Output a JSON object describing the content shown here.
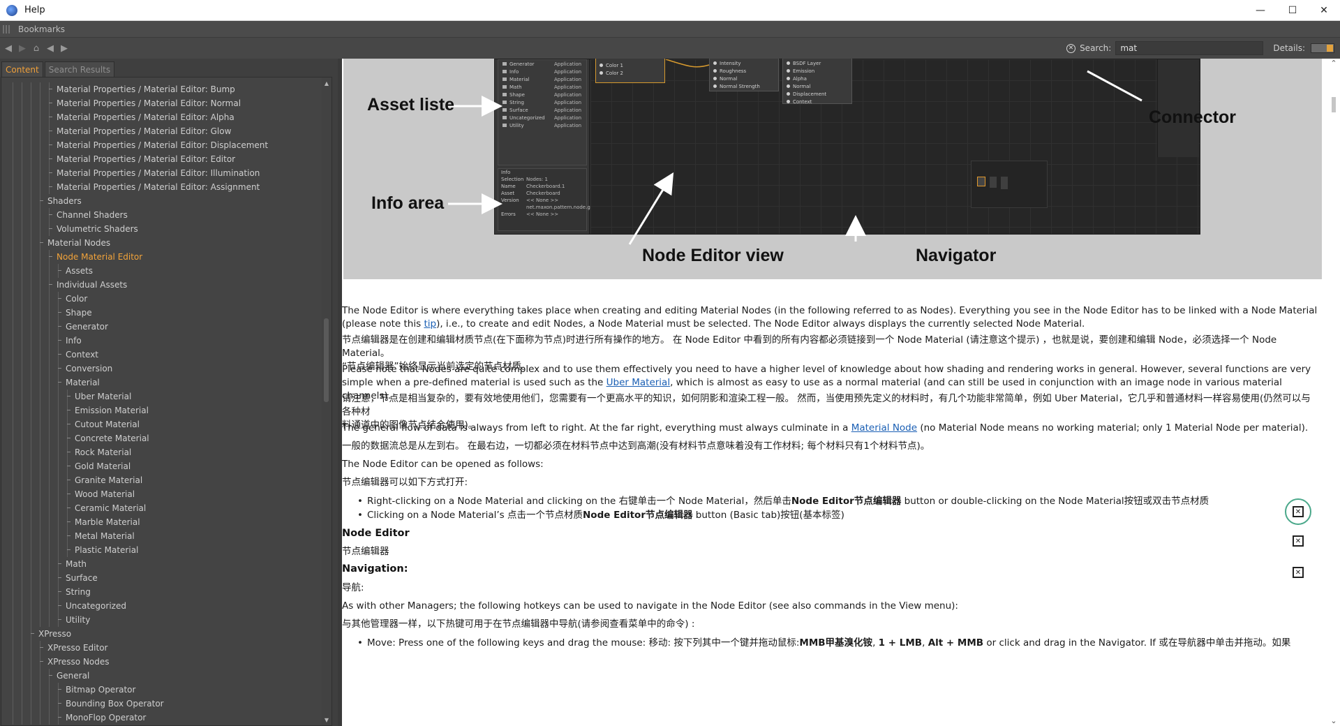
{
  "window": {
    "title": "Help"
  },
  "bookmarks": {
    "label": "Bookmarks"
  },
  "toolbar": {
    "search_label": "Search:",
    "search_value": "mat",
    "details_label": "Details:"
  },
  "tabs": [
    {
      "label": "Content",
      "active": true
    },
    {
      "label": "Search Results",
      "active": false
    }
  ],
  "tree": [
    {
      "label": "Material Properties / Material Editor: Bump",
      "depth": 6
    },
    {
      "label": "Material Properties / Material Editor: Normal",
      "depth": 6
    },
    {
      "label": "Material Properties / Material Editor: Alpha",
      "depth": 6
    },
    {
      "label": "Material Properties / Material Editor: Glow",
      "depth": 6
    },
    {
      "label": "Material Properties / Material Editor: Displacement",
      "depth": 6
    },
    {
      "label": "Material Properties / Material Editor: Editor",
      "depth": 6
    },
    {
      "label": "Material Properties / Material Editor: Illumination",
      "depth": 6
    },
    {
      "label": "Material Properties / Material Editor: Assignment",
      "depth": 6
    },
    {
      "label": "Shaders",
      "depth": 5
    },
    {
      "label": "Channel Shaders",
      "depth": 6
    },
    {
      "label": "Volumetric Shaders",
      "depth": 6
    },
    {
      "label": "Material Nodes",
      "depth": 5
    },
    {
      "label": "Node Material Editor",
      "depth": 6,
      "selected": true
    },
    {
      "label": "Assets",
      "depth": 7
    },
    {
      "label": "Individual Assets",
      "depth": 6
    },
    {
      "label": "Color",
      "depth": 7
    },
    {
      "label": "Shape",
      "depth": 7
    },
    {
      "label": "Generator",
      "depth": 7
    },
    {
      "label": "Info",
      "depth": 7
    },
    {
      "label": "Context",
      "depth": 7
    },
    {
      "label": "Conversion",
      "depth": 7
    },
    {
      "label": "Material",
      "depth": 7
    },
    {
      "label": "Uber Material",
      "depth": 8
    },
    {
      "label": "Emission Material",
      "depth": 8
    },
    {
      "label": "Cutout Material",
      "depth": 8
    },
    {
      "label": "Concrete Material",
      "depth": 8
    },
    {
      "label": "Rock Material",
      "depth": 8
    },
    {
      "label": "Gold Material",
      "depth": 8
    },
    {
      "label": "Granite Material",
      "depth": 8
    },
    {
      "label": "Wood Material",
      "depth": 8
    },
    {
      "label": "Ceramic Material",
      "depth": 8
    },
    {
      "label": "Marble Material",
      "depth": 8
    },
    {
      "label": "Metal Material",
      "depth": 8
    },
    {
      "label": "Plastic Material",
      "depth": 8
    },
    {
      "label": "Math",
      "depth": 7
    },
    {
      "label": "Surface",
      "depth": 7
    },
    {
      "label": "String",
      "depth": 7
    },
    {
      "label": "Uncategorized",
      "depth": 7
    },
    {
      "label": "Utility",
      "depth": 7
    },
    {
      "label": "XPresso",
      "depth": 4
    },
    {
      "label": "XPresso Editor",
      "depth": 5
    },
    {
      "label": "XPresso Nodes",
      "depth": 5
    },
    {
      "label": "General",
      "depth": 6
    },
    {
      "label": "Bitmap Operator",
      "depth": 7
    },
    {
      "label": "Bounding Box Operator",
      "depth": 7
    },
    {
      "label": "MonoFlop Operator",
      "depth": 7
    }
  ],
  "figure": {
    "labels": {
      "asset_list": "Asset liste",
      "info_area": "Info area",
      "connector": "Connector",
      "node_editor_view": "Node Editor view",
      "navigator": "Navigator"
    },
    "asset_rows": [
      {
        "name": "Generator",
        "cat": "Application"
      },
      {
        "name": "Info",
        "cat": "Application"
      },
      {
        "name": "Material",
        "cat": "Application"
      },
      {
        "name": "Math",
        "cat": "Application"
      },
      {
        "name": "Shape",
        "cat": "Application"
      },
      {
        "name": "String",
        "cat": "Application"
      },
      {
        "name": "Surface",
        "cat": "Application"
      },
      {
        "name": "Uncategorized",
        "cat": "Application"
      },
      {
        "name": "Utility",
        "cat": "Application"
      }
    ],
    "info_rows": [
      {
        "k": "Info",
        "v": ""
      },
      {
        "k": "Selection",
        "v": "Nodes: 1"
      },
      {
        "k": "Name",
        "v": "Checkerboard.1"
      },
      {
        "k": "Asset",
        "v": "Checkerboard"
      },
      {
        "k": "Version",
        "v": "<< None >>"
      },
      {
        "k": "",
        "v": "net.maxon.pattern.node.gener"
      },
      {
        "k": "Errors",
        "v": "<< None >>"
      }
    ],
    "node1_rows": [
      "Color 1",
      "Color 2"
    ],
    "node2_rows": [
      "Intensity",
      "Roughness",
      "Normal",
      "Normal Strength"
    ],
    "node3_rows": [
      "BSDF Layer",
      "Emission",
      "Alpha",
      "Normal",
      "Displacement",
      "Context"
    ]
  },
  "article": {
    "p1_a": "The Node Editor is where everything takes place when creating and editing Material Nodes (in the following referred to as Nodes). Everything you see in the Node Editor has to be linked with a Node Material",
    "p1_b_pre": "(please note this ",
    "p1_b_link": "tip",
    "p1_b_post": "), i.e., to create and edit Nodes, a Node Material must be selected. The Node Editor always displays the currently selected Node Material.",
    "p2_a": "节点编辑器是在创建和编辑材质节点(在下面称为节点)时进行所有操作的地方。 在 Node Editor 中看到的所有内容都必须链接到一个 Node Material (请注意这个提示) ，也就是说，要创建和编辑 Node，必须选择一个 Node Material。",
    "p2_b": "“节点编辑器”始终显示当前选定的节点材质。",
    "p3_a": "Please note that Nodes are quite complex and to use them effectively you need to have a higher level of knowledge about how shading and rendering works in general. However, several functions are very",
    "p3_b_pre": "simple when a pre-defined material is used such as the ",
    "p3_b_link": "Uber Material",
    "p3_b_post": ", which is almost as easy to use as a normal material (and can still be used in conjunction with an image node in various material channels).",
    "p4_a": "请注意，节点是相当复杂的，要有效地使用他们，您需要有一个更高水平的知识，如何阴影和渲染工程一般。 然而，当使用预先定义的材料时，有几个功能非常简单，例如 Uber Material，它几乎和普通材料一样容易使用(仍然可以与各种材",
    "p4_b": "料通道中的图像节点结合使用)。",
    "p5_pre": "The general flow of data is always from left to right. At the far right, everything must always culminate in a ",
    "p5_link": "Material Node",
    "p5_post": " (no Material Node means no working material; only 1 Material Node per material).",
    "p6": "一般的数据流总是从左到右。 在最右边，一切都必须在材料节点中达到高潮(没有材料节点意味着没有工作材料; 每个材料只有1个材料节点)。",
    "p7": "The Node Editor can be opened as follows:",
    "p8": "节点编辑器可以如下方式打开:",
    "b1_pre": "Right-clicking on a Node Material and clicking on the 右键单击一个 Node Material，然后单击",
    "b1_bold": "Node Editor节点编辑器",
    "b1_post": " button or double-clicking on the Node Material按钮或双击节点材质",
    "b2_pre": "Clicking on a Node Material’s 点击一个节点材质",
    "b2_bold": "Node Editor节点编辑器",
    "b2_post": " button (Basic tab)按钮(基本标签)",
    "h1": "Node Editor",
    "h1_zh": "节点编辑器",
    "h2": "Navigation:",
    "h2_zh": "导航:",
    "p9": "As with other Managers; the following hotkeys can be used to navigate in the Node Editor (see also commands in the View menu):",
    "p10": "与其他管理器一样，以下热键可用于在节点编辑器中导航(请参阅查看菜单中的命令) :",
    "b3_pre": "Move: Press one of the following keys and drag the mouse: 移动: 按下列其中一个键并拖动鼠标:",
    "b3_bold1": "MMB甲基溴化铵",
    "b3_mid1": ", ",
    "b3_bold2": "1 + LMB",
    "b3_mid2": ", ",
    "b3_bold3": "Alt + MMB",
    "b3_post": " or click and drag in the Navigator. If 或在导航器中单击并拖动。如果"
  }
}
